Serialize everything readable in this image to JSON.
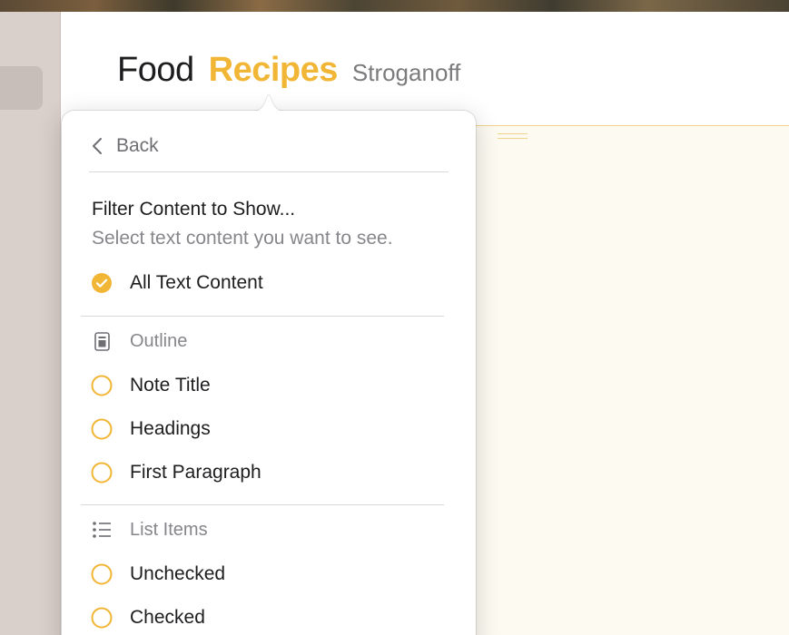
{
  "breadcrumb": {
    "level1": "Food",
    "level2": "Recipes",
    "level3": "Stroganoff"
  },
  "popover": {
    "back_label": "Back",
    "filter_title": "Filter Content to Show...",
    "filter_subtitle": "Select text content you want to see.",
    "all_text_content": {
      "label": "All Text Content",
      "selected": true
    },
    "outline": {
      "section_label": "Outline",
      "section_icon": "document-icon",
      "options": [
        {
          "label": "Note Title",
          "selected": false
        },
        {
          "label": "Headings",
          "selected": false
        },
        {
          "label": "First Paragraph",
          "selected": false
        }
      ]
    },
    "list_items": {
      "section_label": "List Items",
      "section_icon": "list-bullet-icon",
      "options": [
        {
          "label": "Unchecked",
          "selected": false
        },
        {
          "label": "Checked",
          "selected": false
        }
      ]
    }
  },
  "colors": {
    "accent": "#f2b636",
    "sidebar": "#d9cfcb",
    "note_background": "#fdfaf2"
  }
}
